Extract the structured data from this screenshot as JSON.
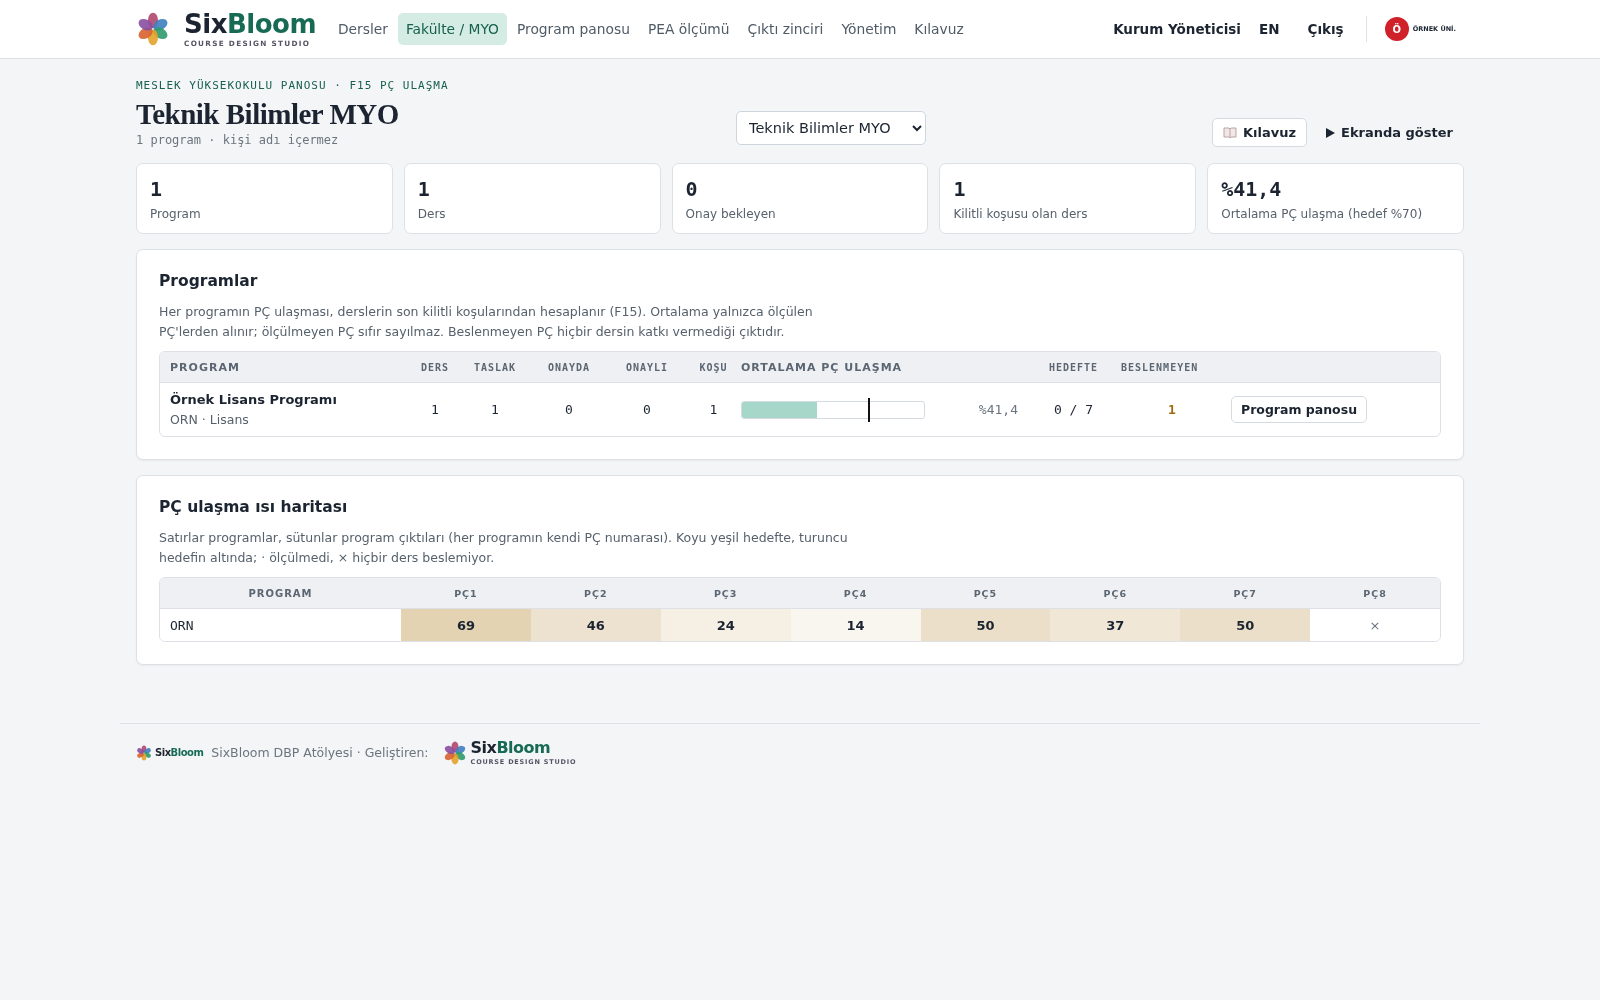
{
  "header": {
    "brand": {
      "first": "Six",
      "second": "Bloom",
      "tagline": "COURSE DESIGN STUDIO"
    },
    "nav": [
      {
        "label": "Dersler",
        "selected": false
      },
      {
        "label": "Fakülte / MYO",
        "selected": true
      },
      {
        "label": "Program panosu",
        "selected": false
      },
      {
        "label": "PEA ölçümü",
        "selected": false
      },
      {
        "label": "Çıktı zinciri",
        "selected": false
      },
      {
        "label": "Yönetim",
        "selected": false
      },
      {
        "label": "Kılavuz",
        "selected": false
      }
    ],
    "user": "Kurum Yöneticisi",
    "language": "EN",
    "logout": "Çıkış",
    "institution": {
      "initial": "Ö",
      "name": "ÖRNEK ÜNİ."
    }
  },
  "page": {
    "breadcrumb": "MESLEK YÜKSEKOKULU PANOSU · F15 PÇ ULAŞMA",
    "title": "Teknik Bilimler MYO",
    "subtitle": "1 program · kişi adı içermez",
    "unit_select": {
      "value": "Teknik Bilimler MYO"
    },
    "guide_button": "Kılavuz",
    "present_button": "Ekranda göster"
  },
  "stats": [
    {
      "value": "1",
      "label": "Program"
    },
    {
      "value": "1",
      "label": "Ders"
    },
    {
      "value": "0",
      "label": "Onay bekleyen"
    },
    {
      "value": "1",
      "label": "Kilitli koşusu olan ders"
    },
    {
      "value": "%41,4",
      "label": "Ortalama PÇ ulaşma (hedef %70)"
    }
  ],
  "programs": {
    "title": "Programlar",
    "description": "Her programın PÇ ulaşması, derslerin son kilitli koşularından hesaplanır (F15). Ortalama yalnızca ölçülen PÇ'lerden alınır; ölçülmeyen PÇ sıfır sayılmaz. Beslenmeyen PÇ hiçbir dersin katkı vermediği çıktıdır.",
    "columns": [
      "PROGRAM",
      "DERS",
      "TASLAK",
      "ONAYDA",
      "ONAYLI",
      "KOŞU",
      "ORTALAMA PÇ ULAŞMA",
      "HEDEFTE",
      "BESLENMEYEN"
    ],
    "rows": [
      {
        "name": "Örnek Lisans Programı",
        "meta": "ORN · Lisans",
        "ders": "1",
        "taslak": "1",
        "onayda": "0",
        "onayli": "0",
        "kosu": "1",
        "attainment": {
          "level": 0.414,
          "target": {
            "level": 0.7
          }
        },
        "average": "%41,4",
        "on_target": "0 / 7",
        "unfed": "1",
        "action": "Program panosu"
      }
    ]
  },
  "heatmap": {
    "title": "PÇ ulaşma ısı haritası",
    "description": "Satırlar programlar, sütunlar program çıktıları (her programın kendi PÇ numarası). Koyu yeşil hedefte, turuncu hedefin altında; · ölçülmedi, × hiçbir ders beslemiyor.",
    "columns": [
      "PROGRAM",
      "PÇ1",
      "PÇ2",
      "PÇ3",
      "PÇ4",
      "PÇ5",
      "PÇ6",
      "PÇ7",
      "PÇ8"
    ],
    "rows": [
      {
        "cells": [
          {
            "kind": "program",
            "text": "ORN",
            "color": "#ffffff"
          },
          {
            "kind": "value",
            "text": "69",
            "color": "#e3d3b3"
          },
          {
            "kind": "value",
            "text": "46",
            "color": "#ede2cf"
          },
          {
            "kind": "value",
            "text": "24",
            "color": "#f5efe4"
          },
          {
            "kind": "value",
            "text": "14",
            "color": "#f9f6ef"
          },
          {
            "kind": "value",
            "text": "50",
            "color": "#ebdfc9"
          },
          {
            "kind": "value",
            "text": "37",
            "color": "#f0e7d7"
          },
          {
            "kind": "value",
            "text": "50",
            "color": "#ebdfc9"
          },
          {
            "kind": "unfed",
            "text": "×",
            "color": "#ffffff"
          }
        ]
      }
    ]
  },
  "footer": {
    "brand": {
      "first": "Six",
      "second": "Bloom"
    },
    "text": "SixBloom DBP Atölyesi · Geliştiren:",
    "developer": {
      "first": "Six",
      "second": "Bloom",
      "tagline": "COURSE DESIGN STUDIO"
    }
  }
}
